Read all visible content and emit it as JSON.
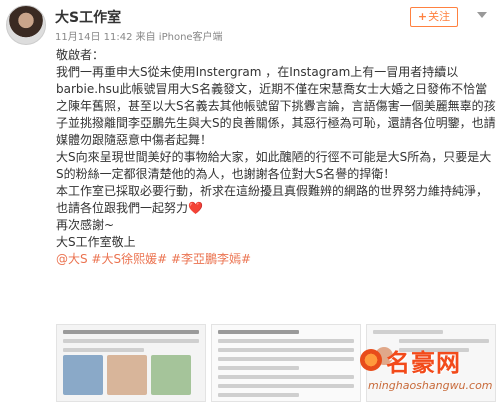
{
  "post": {
    "author": "大S工作室",
    "meta": "11月14日 11:42 来自 iPhone客户端",
    "follow_label": "关注",
    "follow_plus": "+",
    "lines": [
      "敬啟者：",
      "我們一再重申大S從未使用Instergram ，在Instagram上有一冒用者持續以barbie.hsu此帳號冒用大S名義發文，近期不僅在宋慧喬女士大婚之日發佈不恰當之陳年舊照，甚至以大S名義去其他帳號留下挑釁言論，言語傷害一個美麗無辜的孩子並挑撥離間李亞鵬先生與大S的良善關係，其惡行極為可恥，還請各位明鑒，也請媒體勿跟隨惡意中傷者起舞！",
      "大S向來呈現世間美好的事物給大家，如此醜陋的行徑不可能是大S所為，只要是大S的粉絲一定都很清楚他的為人，也謝謝各位對大S名譽的捍衛！",
      "本工作室已採取必要行動，祈求在這紛擾且真假難辨的網路的世界努力維持純淨，也請各位跟我們一起努力❤️",
      "再次感謝~",
      "大S工作室敬上"
    ],
    "tags": "@大S #大S徐熙媛# #李亞鵬李嫣#"
  },
  "watermark": {
    "title": "名豪网",
    "url": "minghaoshangwu.com"
  },
  "colors": {
    "accent": "#ff8140",
    "tag": "#eb7350",
    "watermark": "#f24a1a"
  }
}
